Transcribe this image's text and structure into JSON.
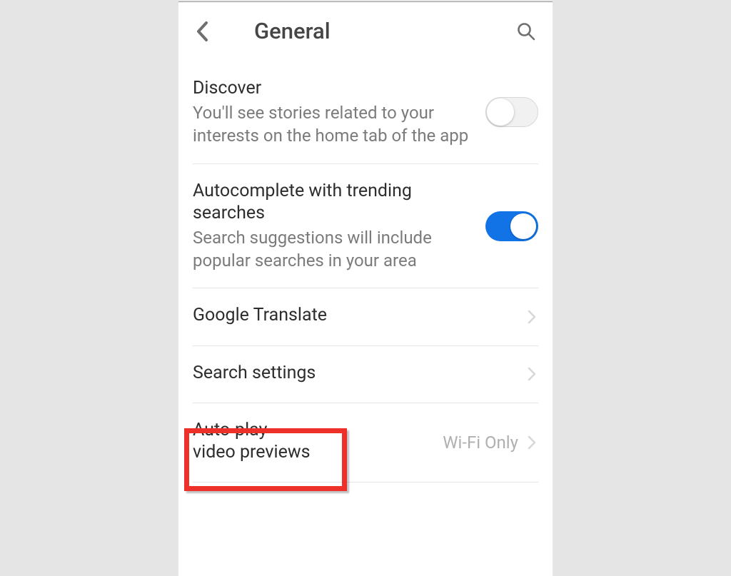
{
  "header": {
    "title": "General"
  },
  "rows": {
    "discover": {
      "title": "Discover",
      "sub": "You'll see stories related to your interests on the home tab of the app",
      "on": false
    },
    "autocomplete": {
      "title": "Autocomplete with trending searches",
      "sub": "Search suggestions will include popular searches in your area",
      "on": true
    },
    "translate": {
      "title": "Google Translate"
    },
    "search_settings": {
      "title": "Search settings"
    },
    "autoplay": {
      "title": "Auto-play video previews",
      "value": "Wi-Fi Only"
    }
  },
  "colors": {
    "accent": "#1173e5",
    "highlight": "#ee302b"
  }
}
